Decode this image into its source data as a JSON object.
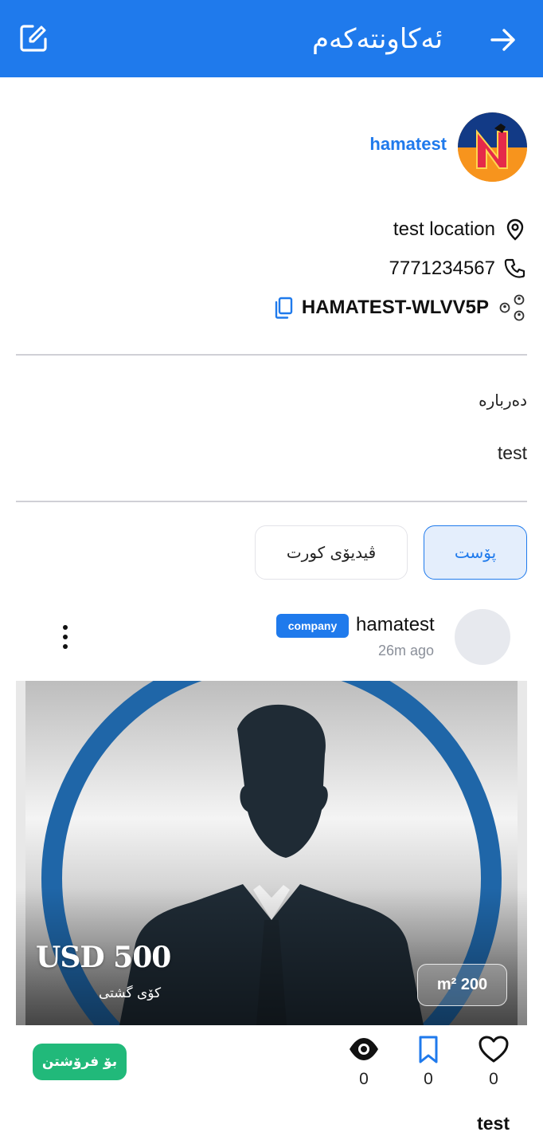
{
  "header": {
    "title": "ئەکاونتەکەم",
    "edit_icon": "edit-icon",
    "back_icon": "arrow-right-icon"
  },
  "profile": {
    "username": "hamatest",
    "location": "test location",
    "phone": "7771234567",
    "referral_code": "HAMATEST-WLVV5P"
  },
  "about": {
    "label": "دەربارە",
    "text": "test"
  },
  "tabs": [
    {
      "label": "پۆست",
      "active": true
    },
    {
      "label": "ڤیدیۆی کورت",
      "active": false
    }
  ],
  "post": {
    "user": "hamatest",
    "badge": "company",
    "time": "26m ago",
    "price": "USD 500",
    "property_type": "کۆی گشتی",
    "area": "m² 200",
    "sale_label": "بۆ فرۆشتن",
    "views": "0",
    "saves": "0",
    "likes": "0",
    "title": "test"
  },
  "colors": {
    "primary": "#1f7aec",
    "sale": "#21b97a"
  }
}
